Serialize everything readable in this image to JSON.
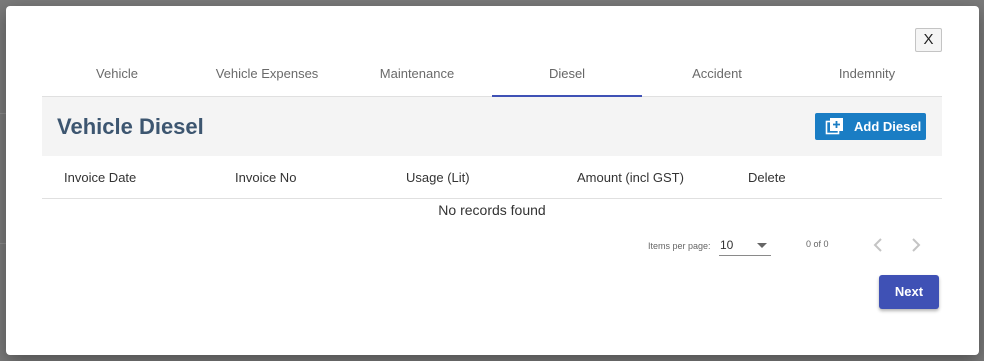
{
  "dialog": {
    "close_label": "X",
    "tabs": [
      {
        "label": "Vehicle"
      },
      {
        "label": "Vehicle Expenses"
      },
      {
        "label": "Maintenance"
      },
      {
        "label": "Diesel"
      },
      {
        "label": "Accident"
      },
      {
        "label": "Indemnity"
      }
    ],
    "active_tab": "Diesel",
    "title": "Vehicle Diesel",
    "add_button_label": "Add Diesel",
    "add_button_icon": "add-box-icon",
    "table": {
      "columns": [
        "Invoice Date",
        "Invoice No",
        "Usage (Lit)",
        "Amount (incl GST)",
        "Delete"
      ],
      "empty_message": "No records found"
    },
    "paginator": {
      "items_per_page_label": "Items per page:",
      "items_per_page_value": "10",
      "range_label": "0 of 0",
      "prev_icon": "chevron-left-icon",
      "next_icon": "chevron-right-icon"
    },
    "next_button_label": "Next"
  },
  "colors": {
    "accent": "#3f51b5",
    "add_button": "#1a7dc4",
    "title": "#3d5670",
    "header_band": "#f4f4f4"
  }
}
